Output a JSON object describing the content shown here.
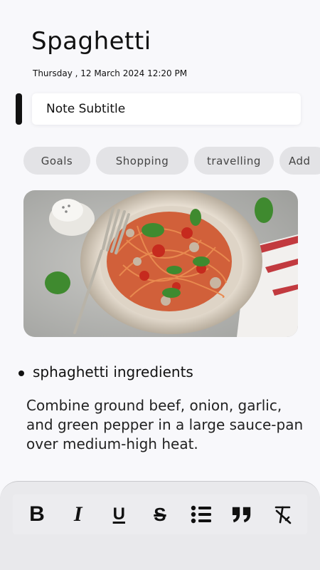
{
  "note": {
    "title": "Spaghetti",
    "datetime": "Thursday , 12 March 2024 12:20 PM",
    "subtitle_placeholder": "Note Subtitle"
  },
  "tags": [
    "Goals",
    "Shopping",
    "travelling",
    "Add"
  ],
  "content": {
    "bullet": "sphaghetti ingredients",
    "paragraph": "Combine ground beef, onion, garlic, and green pepper in a large sauce-pan over medium-high heat."
  },
  "toolbar": {
    "bold": "B",
    "italic": "I",
    "underline": "U",
    "strike": "S"
  },
  "icons": [
    "bold-icon",
    "italic-icon",
    "underline-icon",
    "strikethrough-icon",
    "bullet-list-icon",
    "quote-icon",
    "clear-format-icon"
  ],
  "colors": {
    "accent": "#111111",
    "tag_bg": "#e3e3e6",
    "background": "#f8f8fb"
  }
}
